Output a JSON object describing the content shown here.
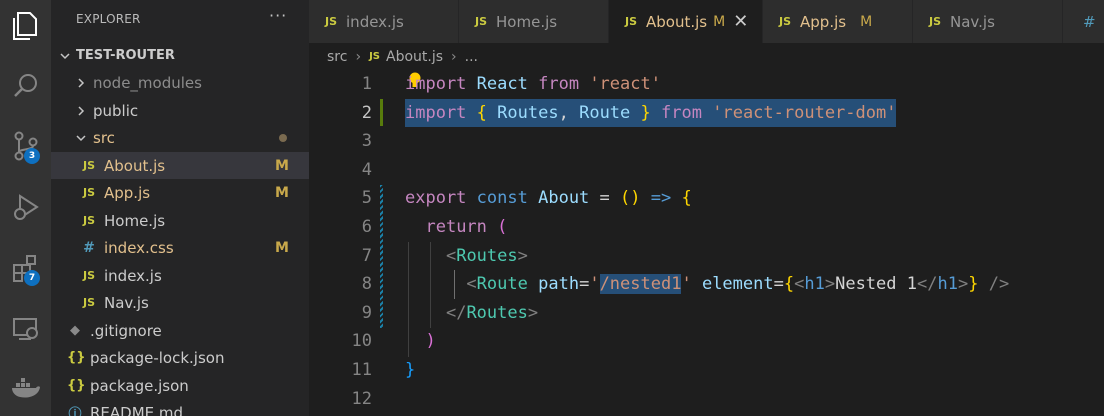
{
  "sidebar": {
    "title": "EXPLORER",
    "more": "···",
    "project": "TEST-ROUTER",
    "items": [
      {
        "label": "node_modules",
        "kind": "folder"
      },
      {
        "label": "public",
        "kind": "folder"
      },
      {
        "label": "src",
        "kind": "folder-open"
      },
      {
        "label": "About.js",
        "kind": "js",
        "badge": "M"
      },
      {
        "label": "App.js",
        "kind": "js",
        "badge": "M"
      },
      {
        "label": "Home.js",
        "kind": "js"
      },
      {
        "label": "index.css",
        "kind": "css",
        "badge": "M"
      },
      {
        "label": "index.js",
        "kind": "js"
      },
      {
        "label": "Nav.js",
        "kind": "js"
      },
      {
        "label": ".gitignore",
        "kind": "git"
      },
      {
        "label": "package-lock.json",
        "kind": "json"
      },
      {
        "label": "package.json",
        "kind": "json"
      },
      {
        "label": "README.md",
        "kind": "info"
      }
    ]
  },
  "activity": {
    "icons": [
      "files-icon",
      "search-icon",
      "source-control-icon",
      "run-debug-icon",
      "extensions-icon",
      "remote-explorer-icon",
      "docker-icon"
    ],
    "scm_badge": "3",
    "extensions_badge": "7"
  },
  "tabs": [
    {
      "label": "index.js",
      "icon": "JS"
    },
    {
      "label": "Home.js",
      "icon": "JS"
    },
    {
      "label": "About.js",
      "icon": "JS",
      "modified": "M",
      "close": "✕"
    },
    {
      "label": "App.js",
      "icon": "JS",
      "modified": "M"
    },
    {
      "label": "Nav.js",
      "icon": "JS"
    },
    {
      "label": "",
      "icon": "#"
    }
  ],
  "breadcrumb": {
    "folder": "src",
    "file_icon": "JS",
    "file": "About.js",
    "more": "..."
  },
  "editor": {
    "line_numbers": [
      "1",
      "2",
      "3",
      "4",
      "5",
      "6",
      "7",
      "8",
      "9",
      "10",
      "11",
      "12"
    ],
    "lines": [
      "import React from 'react'",
      "import { Routes, Route } from 'react-router-dom'",
      "",
      "",
      "export const About = () => {",
      "  return (",
      "    <Routes>",
      "      <Route path='/nested1' element={<h1>Nested 1</h1>} />",
      "    </Routes>",
      "  )",
      "}",
      ""
    ]
  },
  "colors": {
    "keyword": "#c586c0",
    "storage": "#569cd6",
    "variable": "#9cdcfe",
    "string": "#ce9178",
    "tag": "#4ec9b0",
    "selection": "#264f78",
    "modified_badge": "#c9a94b"
  }
}
